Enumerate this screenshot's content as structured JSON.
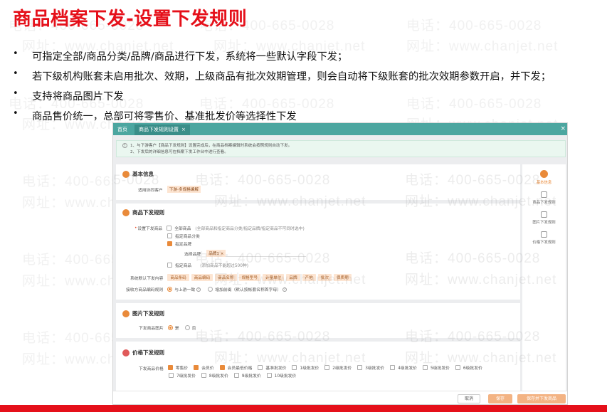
{
  "slide": {
    "title": "商品档案下发-设置下发规则",
    "bullets": [
      "可指定全部/商品分类/品牌/商品进行下发，系统将一些默认字段下发；",
      "若下级机构账套未启用批次、效期，上级商品有批次效期管理，则会自动将下级账套的批次效期参数开启，并下发；",
      "支持将商品图片下发",
      "商品售价统一，总部可将零售价、基准批发价等选择性下发"
    ],
    "watermark_phone": "电话：400-665-0028",
    "watermark_url": "网址：www.chanjet.net"
  },
  "window": {
    "tab_home": "首页",
    "tab_active": "商品下发规则设置",
    "tab_close": "×",
    "close": "×",
    "notice_lines": [
      "1、与下游客户【商品下发规则】设置完成后，在商品档案编辑时系统会按照规则自动下发。",
      "2、下发后的详细信息可在档案下发工作台中进行查看。"
    ],
    "basic": {
      "title": "基本信息",
      "customer_label": "适用协同客户",
      "customer_value": "下游-多规格编解"
    },
    "rules": {
      "title": "商品下发规则",
      "set_label": "设置下发商品",
      "all_goods": "全部商品",
      "all_goods_note": "(全部商品和指定商品分类/指定品牌/指定商品不可同时选中)",
      "by_category": "指定商品分类",
      "by_brand": "指定品牌",
      "brand_select_label": "选择品牌",
      "brand_chip": "品牌1 ×",
      "by_goods": "指定商品",
      "by_goods_note": "(添加商品不能超过500种)",
      "default_fields_label": "系统默认下发内容",
      "default_fields": [
        "商品条码",
        "商品编码",
        "商品名称",
        "规格型号",
        "计量单位",
        "品牌",
        "产地",
        "批次",
        "保质期"
      ],
      "coding_label": "接收方商品编码规则",
      "coding_opt1": "与上游一致",
      "coding_opt2": "增加前缀（默认按帐套名称首字母）"
    },
    "image": {
      "title": "图片下发规则",
      "label": "下发商品图片",
      "yes": "是",
      "no": "否"
    },
    "price": {
      "title": "价格下发规则",
      "label": "下发商品价格",
      "items": [
        "零售价",
        "会员价",
        "会员最低价格",
        "基准批发价",
        "1级批发价",
        "2级批发价",
        "3级批发价",
        "4级批发价",
        "5级批发价",
        "6级批发价",
        "7级批发价",
        "8级批发价",
        "9级批发价",
        "10级批发价"
      ],
      "checked": [
        true,
        true,
        true,
        false,
        false,
        false,
        false,
        false,
        false,
        false,
        false,
        false,
        false,
        false
      ]
    },
    "side": [
      "基本信息",
      "商品下发规则",
      "图片下发规则",
      "价格下发规则"
    ],
    "footer": {
      "cancel": "取消",
      "save": "保存",
      "save_dist": "保存并下发商品"
    }
  }
}
